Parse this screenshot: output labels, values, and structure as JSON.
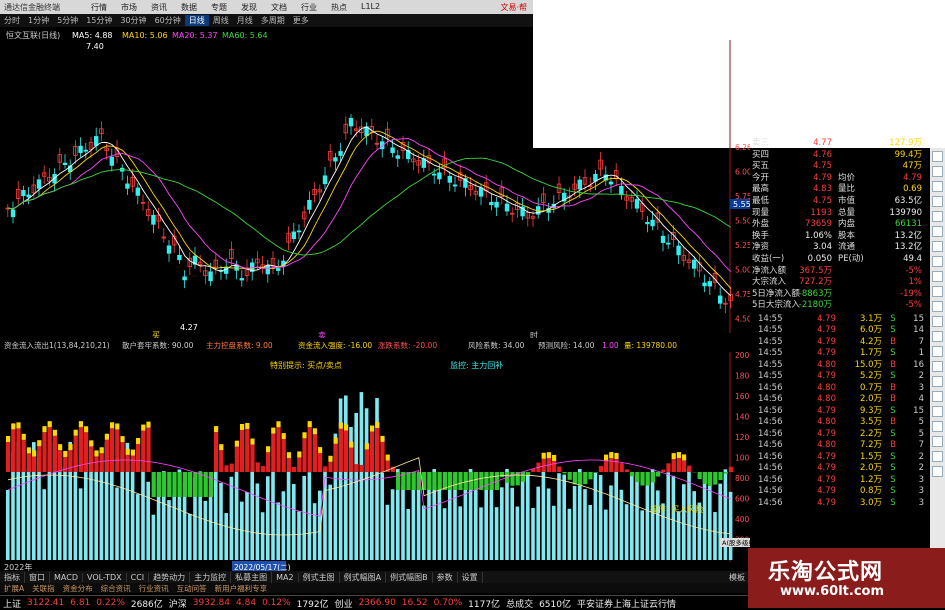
{
  "app": {
    "title": "通达信金融终端"
  },
  "menu": [
    "行情",
    "市场",
    "资讯",
    "数据",
    "专题",
    "发现",
    "文档",
    "行业",
    "热点",
    "L1L2"
  ],
  "menu_right": "文易·帮",
  "periods": [
    "分时",
    "1分钟",
    "5分钟",
    "15分钟",
    "30分钟",
    "60分钟",
    "日线",
    "周线",
    "月线",
    "多周期",
    "更多"
  ],
  "active_period": "日线",
  "main": {
    "stock_name": "恒文互联(日线)",
    "ma": [
      {
        "label": "MA5: 4.88",
        "color": "#ffffff"
      },
      {
        "label": "MA10: 5.06",
        "color": "#ffd700"
      },
      {
        "label": "MA20: 5.37",
        "color": "#ff44ff"
      },
      {
        "label": "MA60: 5.64",
        "color": "#3ad63a"
      }
    ],
    "annotations": {
      "high": "7.40",
      "low": "4.27",
      "buy": "买",
      "sell": "卖",
      "t": "时"
    },
    "axis": [
      "6.26",
      "6.00",
      "5.75",
      "5.50",
      "5.25",
      "5.00",
      "4.75",
      "4.50"
    ],
    "price_tag": "5.55"
  },
  "indicator": {
    "header": [
      {
        "text": "资金流入流出1(13,84,210,21)",
        "color": "#cccccc"
      },
      {
        "text": "散户套牢系数: 90.00",
        "color": "#cccccc"
      },
      {
        "text": "主力控盘系数: 9.00",
        "color": "#ff7a3a"
      },
      {
        "text": "资金流入强度: -16.00",
        "color": "#ffd700"
      },
      {
        "text": "涨跌系数: -20.00",
        "color": "#ff5050"
      },
      {
        "text": "风险系数: 34.00",
        "color": "#cccccc"
      },
      {
        "text": "预测风险: 14.00",
        "color": "#cccccc"
      },
      {
        "text": "1.00",
        "color": "#ff44ff"
      },
      {
        "text": "量: 139780.00",
        "color": "#ffd700"
      }
    ],
    "notes": {
      "special": "特别提示: 买点/卖点",
      "monitor": "监控: 主力回补",
      "op": "操作: 买入风险"
    },
    "axis": [
      "20000",
      "18000",
      "16000",
      "14000",
      "12000",
      "10000",
      "8000",
      "6000",
      "4000",
      "2000"
    ],
    "date_left": "2022年",
    "date_mid": "2022/05/17(二)",
    "corner": "A(股多级线)"
  },
  "quote": [
    {
      "a": "卖三",
      "b": "4.77",
      "bc": "red",
      "c": "",
      "d": "127.9万",
      "dc": "yel"
    },
    {
      "a": "买四",
      "b": "4.76",
      "bc": "red",
      "c": "",
      "d": "99.4万",
      "dc": "yel"
    },
    {
      "a": "买五",
      "b": "4.75",
      "bc": "red",
      "c": "",
      "d": "47万",
      "dc": "yel"
    },
    {
      "a": "今开",
      "b": "4.79",
      "bc": "red",
      "c": "均价",
      "d": "4.79",
      "dc": "red"
    },
    {
      "a": "最高",
      "b": "4.83",
      "bc": "red",
      "c": "量比",
      "d": "0.69",
      "dc": "yel"
    },
    {
      "a": "最低",
      "b": "4.75",
      "bc": "red",
      "c": "市值",
      "d": "63.5亿",
      "dc": "wht"
    },
    {
      "a": "现量",
      "b": "1193",
      "bc": "red",
      "c": "总量",
      "d": "139790",
      "dc": "wht"
    },
    {
      "a": "外盘",
      "b": "73659",
      "bc": "red",
      "c": "内盘",
      "d": "66131",
      "dc": "grn"
    },
    {
      "a": "换手",
      "b": "1.06%",
      "bc": "wht",
      "c": "股本",
      "d": "13.2亿",
      "dc": "wht"
    },
    {
      "a": "净资",
      "b": "3.04",
      "bc": "wht",
      "c": "流通",
      "d": "13.2亿",
      "dc": "wht"
    },
    {
      "a": "收益(一)",
      "b": "0.050",
      "bc": "wht",
      "c": "PE(动)",
      "d": "49.4",
      "dc": "wht"
    },
    {
      "a": "净流入额",
      "b": "367.5万",
      "bc": "red",
      "c": "",
      "d": "-5%",
      "dc": "red"
    },
    {
      "a": "大宗流入",
      "b": "727.2万",
      "bc": "red",
      "c": "",
      "d": "1%",
      "dc": "red"
    },
    {
      "a": "5日净流入额",
      "b": "-8863万",
      "bc": "grn",
      "c": "",
      "d": "-19%",
      "dc": "red"
    },
    {
      "a": "5日大宗流入",
      "b": "-2180万",
      "bc": "grn",
      "c": "",
      "d": "-5%",
      "dc": "red"
    }
  ],
  "ticks": [
    {
      "t": "14:55",
      "p": "4.79",
      "v": "3.1万",
      "s": "S",
      "n": "15"
    },
    {
      "t": "14:55",
      "p": "4.79",
      "v": "6.0万",
      "s": "S",
      "n": "14"
    },
    {
      "t": "14:55",
      "p": "4.79",
      "v": "4.2万",
      "s": "B",
      "n": "7"
    },
    {
      "t": "14:55",
      "p": "4.79",
      "v": "1.7万",
      "s": "S",
      "n": "1"
    },
    {
      "t": "14:55",
      "p": "4.80",
      "v": "15.0万",
      "s": "B",
      "n": "16"
    },
    {
      "t": "14:55",
      "p": "4.79",
      "v": "5.2万",
      "s": "S",
      "n": "2"
    },
    {
      "t": "14:56",
      "p": "4.80",
      "v": "0.7万",
      "s": "B",
      "n": "3"
    },
    {
      "t": "14:56",
      "p": "4.80",
      "v": "2.0万",
      "s": "B",
      "n": "4"
    },
    {
      "t": "14:56",
      "p": "4.79",
      "v": "9.3万",
      "s": "S",
      "n": "15"
    },
    {
      "t": "14:56",
      "p": "4.80",
      "v": "3.5万",
      "s": "B",
      "n": "5"
    },
    {
      "t": "14:56",
      "p": "4.79",
      "v": "2.2万",
      "s": "S",
      "n": "5"
    },
    {
      "t": "14:56",
      "p": "4.80",
      "v": "7.2万",
      "s": "B",
      "n": "7"
    },
    {
      "t": "14:56",
      "p": "4.79",
      "v": "1.5万",
      "s": "S",
      "n": "2"
    },
    {
      "t": "14:56",
      "p": "4.79",
      "v": "2.0万",
      "s": "S",
      "n": "2"
    },
    {
      "t": "14:56",
      "p": "4.79",
      "v": "1.2万",
      "s": "S",
      "n": "3"
    },
    {
      "t": "14:56",
      "p": "4.79",
      "v": "0.8万",
      "s": "S",
      "n": "3"
    },
    {
      "t": "14:56",
      "p": "4.79",
      "v": "3.0万",
      "s": "S",
      "n": "3"
    }
  ],
  "tabs": [
    "指标",
    "窗口",
    "MACD",
    "VOL-TDX",
    "CCI",
    "趋势动力",
    "主力监控",
    "私募主图",
    "MA2",
    "例式主图",
    "例式幅图A",
    "例式幅图B",
    "参数",
    "设置"
  ],
  "tabs_right": "模板",
  "tabs2": [
    "扩展A",
    "关联指",
    "资金分布",
    "综合资讯",
    "行业资讯",
    "互动问答",
    "新用户福利专享"
  ],
  "status": [
    {
      "text": "上证",
      "c": "wht"
    },
    {
      "text": "3122.41",
      "c": "red"
    },
    {
      "text": "6.81",
      "c": "red"
    },
    {
      "text": "0.22%",
      "c": "red"
    },
    {
      "text": "2686亿",
      "c": "wht"
    },
    {
      "text": "沪深",
      "c": "wht"
    },
    {
      "text": "3932.84",
      "c": "red"
    },
    {
      "text": "4.84",
      "c": "red"
    },
    {
      "text": "0.12%",
      "c": "red"
    },
    {
      "text": "1792亿",
      "c": "wht"
    },
    {
      "text": "创业",
      "c": "wht"
    },
    {
      "text": "2366.90",
      "c": "red"
    },
    {
      "text": "16.52",
      "c": "red"
    },
    {
      "text": "0.70%",
      "c": "red"
    },
    {
      "text": "1177亿",
      "c": "wht"
    },
    {
      "text": "总成交",
      "c": "wht"
    },
    {
      "text": "6510亿",
      "c": "wht"
    },
    {
      "text": "平安证券上海上证云行情",
      "c": "wht"
    }
  ],
  "brand": {
    "name": "乐淘公式网",
    "url": "www.60lt.com"
  }
}
